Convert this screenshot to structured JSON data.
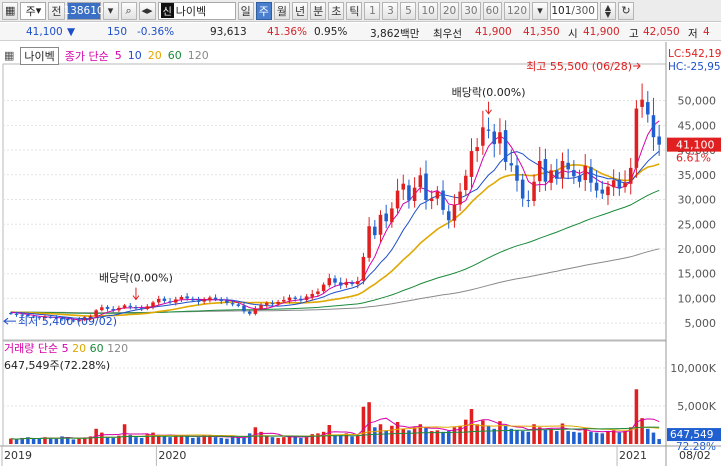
{
  "toolbar": {
    "market": "주",
    "prev": "전",
    "code": "138610",
    "stock_tag": "신",
    "stock_name": "나이벡",
    "periods": [
      "일",
      "주",
      "월",
      "년",
      "분",
      "초",
      "틱"
    ],
    "active_period": "주",
    "intervals": [
      "1",
      "3",
      "5",
      "10",
      "20",
      "30",
      "60",
      "120"
    ],
    "count": "101",
    "count_total": "/300"
  },
  "quote": {
    "price": "41,100",
    "change": "150",
    "change_pct": "-0.36%",
    "volume": "93,613",
    "vol_ratio": "41.36%",
    "turnover_pct": "0.95%",
    "amount": "3,862백만",
    "pref_label": "최우선",
    "ask": "41,900",
    "bid": "41,350",
    "open_label": "시",
    "open": "41,900",
    "high_label": "고",
    "high": "42,050",
    "low_label": "저",
    "low": "4"
  },
  "price_panel": {
    "stock_name": "나이벡",
    "ma_title": "종가 단순",
    "ma_periods": [
      {
        "label": "5",
        "color": "#d600a8"
      },
      {
        "label": "10",
        "color": "#1f4fc8"
      },
      {
        "label": "20",
        "color": "#e0a800"
      },
      {
        "label": "60",
        "color": "#1a8a3a"
      },
      {
        "label": "120",
        "color": "#8a8a8a"
      }
    ],
    "lc_label": "LC:542,19",
    "hc_label": "HC:-25,95",
    "y_ticks": [
      "50,000",
      "45,000",
      "40,000",
      "35,000",
      "30,000",
      "25,000",
      "20,000",
      "15,000",
      "10,000",
      "5,000"
    ],
    "current_price_badge": "41,100",
    "current_pct": "6.61%",
    "annotation_high": "최고 55,500 (06/28)",
    "annotation_low": "최저 5,400 (09/02)",
    "annotation_div1": "배당락(0.00%)",
    "annotation_div2": "배당락(0.00%)"
  },
  "volume_panel": {
    "title": "거래량",
    "ma_title": "단순",
    "ma_periods": [
      {
        "label": "5",
        "color": "#d600a8"
      },
      {
        "label": "20",
        "color": "#e0a800"
      },
      {
        "label": "60",
        "color": "#1a8a3a"
      },
      {
        "label": "120",
        "color": "#8a8a8a"
      }
    ],
    "current": "647,549주(72.28%)",
    "y_ticks": [
      "10,000K",
      "5,000K"
    ],
    "badge_value": "647,549",
    "badge_pct": "72.28%"
  },
  "x_axis": {
    "labels": [
      "2019",
      "2020",
      "2021",
      "08/02"
    ]
  },
  "colors": {
    "up": "#e02020",
    "down": "#1f5fd0",
    "toolbar_active": "#4a7fcf",
    "ma5": "#d600a8",
    "ma10": "#1f4fc8",
    "ma20": "#e0a800",
    "ma60": "#1a8a3a",
    "ma120": "#8a8a8a"
  },
  "chart_data": {
    "type": "candlestick",
    "interval": "weekly",
    "ylim": [
      2000,
      57000
    ],
    "price_closes": [
      6900,
      6700,
      6600,
      6400,
      6200,
      6000,
      6300,
      6200,
      6000,
      5800,
      5600,
      5400,
      5700,
      6000,
      6400,
      7600,
      8200,
      7900,
      7600,
      8100,
      8600,
      8300,
      8000,
      7800,
      8400,
      9200,
      9900,
      9500,
      9200,
      9800,
      10300,
      10000,
      9600,
      9300,
      9700,
      10200,
      9800,
      9500,
      9100,
      8800,
      8500,
      7400,
      6900,
      7900,
      8600,
      9100,
      8900,
      9300,
      9700,
      10200,
      9900,
      9600,
      10400,
      10900,
      11400,
      12800,
      14100,
      13200,
      12600,
      13300,
      12900,
      13500,
      18400,
      24600,
      22800,
      26900,
      25600,
      28200,
      31800,
      33200,
      29800,
      32400,
      34900,
      29900,
      30200,
      31600,
      27900,
      25800,
      28900,
      31600,
      34800,
      39800,
      40600,
      44600,
      43900,
      41200,
      43600,
      37600,
      36900,
      33800,
      30200,
      29800,
      33600,
      37800,
      33600,
      35900,
      34200,
      37800,
      36100,
      34700,
      33600,
      36800,
      33400,
      31800,
      31200,
      32600,
      33900,
      32200,
      33400,
      36400,
      48400,
      50200,
      47200,
      42600,
      41100
    ],
    "volume_k": [
      700,
      600,
      800,
      900,
      650,
      700,
      900,
      800,
      700,
      1000,
      900,
      600,
      700,
      800,
      1000,
      2000,
      1500,
      900,
      800,
      1100,
      2600,
      1200,
      900,
      800,
      1300,
      1500,
      1200,
      1000,
      900,
      1100,
      1200,
      1000,
      800,
      900,
      1100,
      1200,
      900,
      800,
      700,
      1000,
      900,
      800,
      1400,
      2200,
      1600,
      1000,
      900,
      800,
      900,
      1100,
      1000,
      800,
      900,
      1300,
      1400,
      1600,
      2500,
      1200,
      1200,
      1400,
      1000,
      1100,
      4900,
      5500,
      2200,
      2600,
      1800,
      2400,
      2900,
      2000,
      1800,
      2200,
      2600,
      2100,
      1700,
      1800,
      1600,
      1700,
      2200,
      2400,
      3200,
      4600,
      2600,
      3100,
      2400,
      2000,
      3000,
      2400,
      2000,
      1800,
      1700,
      1600,
      2600,
      2200,
      1900,
      2000,
      1700,
      2700,
      1700,
      1600,
      1500,
      2100,
      1600,
      1500,
      1400,
      1700,
      1800,
      1500,
      1700,
      2200,
      7200,
      3400,
      2000,
      1500,
      650
    ]
  }
}
